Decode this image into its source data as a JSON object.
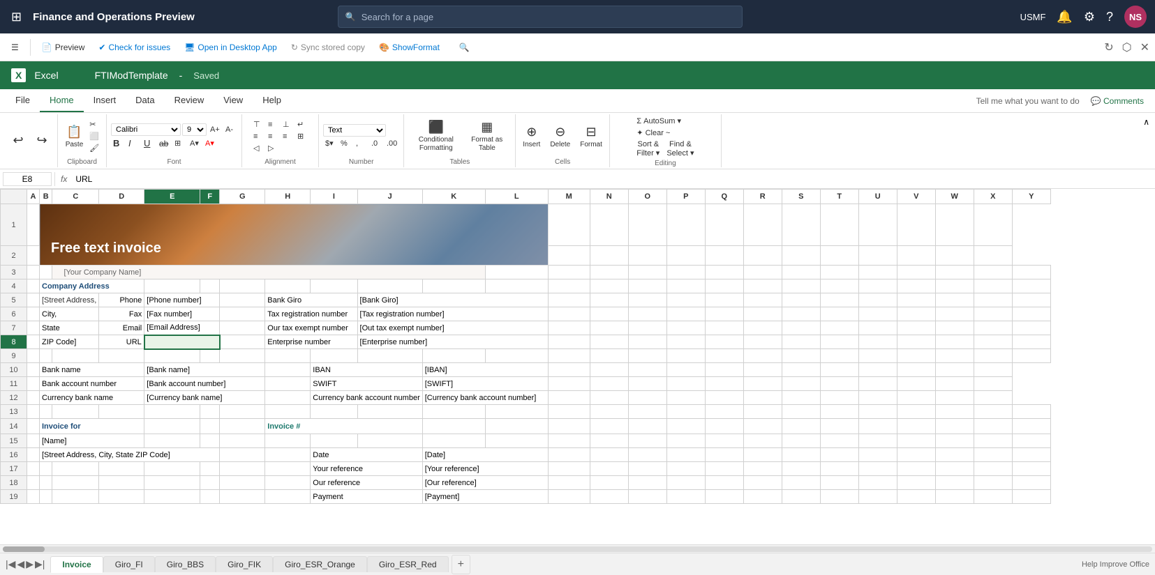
{
  "topbar": {
    "waffle_icon": "⊞",
    "title": "Finance and Operations Preview",
    "search_placeholder": "Search for a page",
    "user": "USMF",
    "avatar_initials": "NS"
  },
  "app_toolbar": {
    "preview_label": "Preview",
    "check_issues_label": "Check for issues",
    "open_desktop_label": "Open in Desktop App",
    "sync_label": "Sync stored copy",
    "show_format_label": "ShowFormat"
  },
  "excel": {
    "logo": "X",
    "app_name": "Excel",
    "file_name": "FTIModTemplate",
    "saved_status": "Saved"
  },
  "ribbon": {
    "tabs": [
      "File",
      "Home",
      "Insert",
      "Data",
      "Review",
      "View",
      "Help"
    ],
    "active_tab": "Home",
    "tell_me": "Tell me what you want to do",
    "comments_label": "Comments",
    "undo_label": "↩",
    "redo_label": "↪",
    "paste_label": "Paste",
    "clipboard_label": "Clipboard",
    "font_name": "Calibri",
    "font_size": "9",
    "bold_label": "B",
    "italic_label": "I",
    "underline_label": "U",
    "strikethrough_label": "ab",
    "font_label": "Font",
    "align_left": "≡",
    "align_center": "≡",
    "align_right": "≡",
    "wrap_text": "⇔",
    "alignment_label": "Alignment",
    "number_format": "Text",
    "number_label": "Number",
    "cond_format_label": "Conditional\nFormatting",
    "format_table_label": "Format\nas Table",
    "tables_label": "Tables",
    "insert_label": "Insert",
    "delete_label": "Delete",
    "format_label": "Format",
    "cells_label": "Cells",
    "autosum_label": "AutoSum",
    "sort_filter_label": "Sort &\nFilter",
    "find_select_label": "Find &\nSelect",
    "editing_label": "Editing",
    "clear_label": "Clear ~"
  },
  "formula_bar": {
    "cell_ref": "E8",
    "fx_label": "fx",
    "formula_value": "URL"
  },
  "columns": {
    "headers": [
      "A",
      "B",
      "C",
      "D",
      "E",
      "F",
      "G",
      "H",
      "I",
      "J",
      "K",
      "L",
      "M",
      "N",
      "O",
      "P",
      "Q",
      "R",
      "S",
      "T",
      "U",
      "V",
      "W",
      "X",
      "Y"
    ],
    "widths": [
      25,
      15,
      60,
      60,
      80,
      30,
      60,
      60,
      60,
      80,
      80,
      80,
      80,
      60,
      60,
      60,
      60,
      60,
      60,
      60,
      60,
      60,
      60,
      60,
      60
    ]
  },
  "rows": {
    "numbers": [
      1,
      2,
      3,
      4,
      5,
      6,
      7,
      8,
      9,
      10,
      11,
      12,
      13,
      14,
      15,
      16,
      17,
      18,
      19
    ]
  },
  "invoice": {
    "banner_title": "Free text invoice",
    "company_name": "[Your Company Name]",
    "company_address_label": "Company Address",
    "street_label": "[Street Address,",
    "city_label": "City,",
    "state_label": "State",
    "zip_label": "ZIP Code]",
    "phone_label": "Phone",
    "fax_label": "Fax",
    "email_label": "Email",
    "url_label": "URL",
    "phone_value": "[Phone number]",
    "fax_value": "[Fax number]",
    "email_value": "[Email Address]",
    "bank_giro_label": "Bank Giro",
    "bank_giro_value": "[Bank Giro]",
    "tax_reg_label": "Tax registration number",
    "tax_reg_value": "[Tax registration number]",
    "tax_exempt_label": "Our tax exempt number",
    "tax_exempt_value": "[Out tax exempt number]",
    "enterprise_label": "Enterprise number",
    "enterprise_value": "[Enterprise number]",
    "bank_name_label": "Bank name",
    "bank_name_value": "[Bank name]",
    "bank_acct_label": "Bank account number",
    "bank_acct_value": "[Bank account number]",
    "currency_bank_label": "Currency bank name",
    "currency_bank_value": "[Currency bank name]",
    "iban_label": "IBAN",
    "iban_value": "[IBAN]",
    "swift_label": "SWIFT",
    "swift_value": "[SWIFT]",
    "currency_acct_label": "Currency bank account number",
    "currency_acct_value": "[Currency bank account number]",
    "invoice_for_label": "Invoice for",
    "invoice_hash_label": "Invoice #",
    "name_value": "[Name]",
    "address_value": "[Street Address, City, State ZIP Code]",
    "date_label": "Date",
    "date_value": "[Date]",
    "your_ref_label": "Your reference",
    "your_ref_value": "[Your reference]",
    "our_ref_label": "Our reference",
    "our_ref_value": "[Our reference]",
    "payment_label": "Payment",
    "payment_value": "[Payment]"
  },
  "sheet_tabs": {
    "tabs": [
      "Invoice",
      "Giro_FI",
      "Giro_BBS",
      "Giro_FIK",
      "Giro_ESR_Orange",
      "Giro_ESR_Red"
    ],
    "active": "Invoice"
  },
  "status_bar": {
    "help_text": "Help Improve Office"
  }
}
